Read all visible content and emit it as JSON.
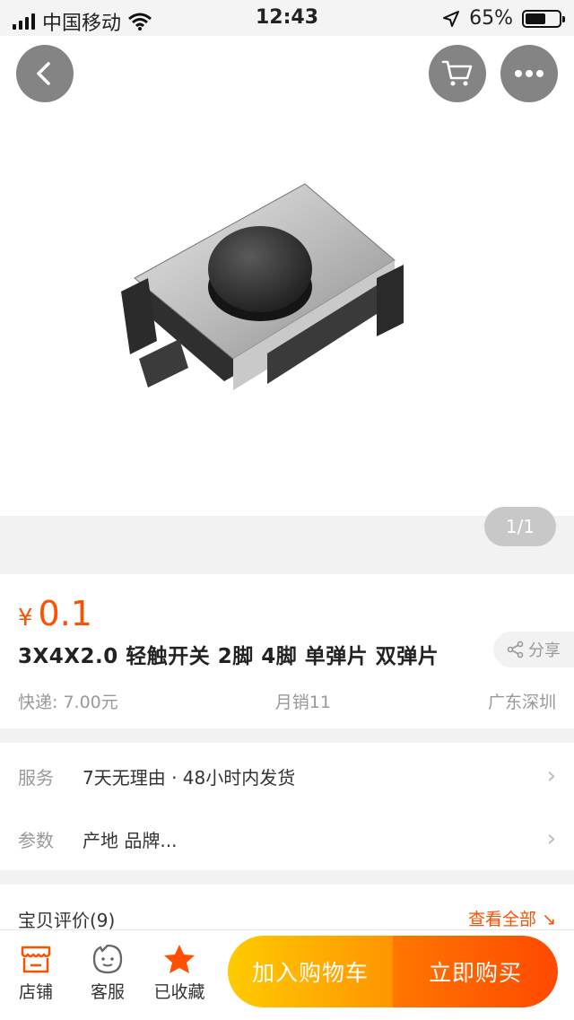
{
  "status_bar": {
    "carrier": "中国移动",
    "time": "12:43",
    "battery_percent": "65%",
    "battery_level": 0.65
  },
  "gallery": {
    "page_indicator": "1/1",
    "icons": [
      "back-icon",
      "cart-icon",
      "more-icon"
    ]
  },
  "product": {
    "currency": "¥",
    "price": "0.1",
    "title": "3X4X2.0 轻触开关 2脚 4脚 单弹片 双弹片",
    "share_label": "分享",
    "shipping": "快递: 7.00元",
    "monthly_sales": "月销11",
    "location": "广东深圳"
  },
  "services": {
    "service_label": "服务",
    "service_value": "7天无理由 · 48小时内发货",
    "params_label": "参数",
    "params_value": "产地 品牌..."
  },
  "reviews": {
    "title": "宝贝评价(9)",
    "view_all": "查看全部"
  },
  "bottom_bar": {
    "shop_label": "店铺",
    "service_label": "客服",
    "favorite_label": "已收藏",
    "add_to_cart": "加入购物车",
    "buy_now": "立即购买"
  },
  "colors": {
    "accent": "#ff5000",
    "cart_gradient_start": "#ffcb00",
    "buy_gradient_end": "#ff4900"
  }
}
